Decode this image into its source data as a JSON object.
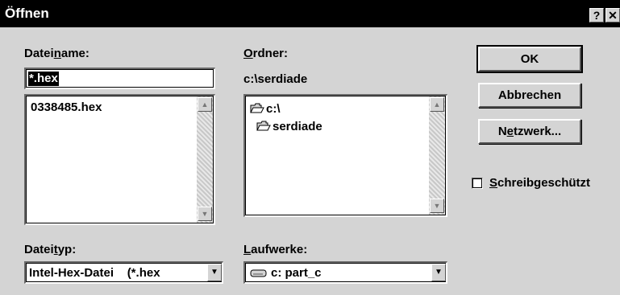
{
  "window": {
    "title": "Öffnen",
    "help_label": "?",
    "close_label": "✕"
  },
  "filename": {
    "label_pre": "Datei",
    "label_mnemonic": "n",
    "label_post": "ame:",
    "value": "*.hex",
    "files": [
      "0338485.hex"
    ]
  },
  "folder": {
    "label_mnemonic": "O",
    "label_post": "rdner:",
    "current_path": "c:\\serdiade",
    "items": [
      {
        "name": "c:\\",
        "icon": "open-folder-icon"
      },
      {
        "name": "serdiade",
        "icon": "open-folder-icon"
      }
    ]
  },
  "buttons": {
    "ok": "OK",
    "cancel": "Abbrechen",
    "network_pre": "N",
    "network_mnemonic": "e",
    "network_post": "tzwerk..."
  },
  "readonly": {
    "label_mnemonic": "S",
    "label_post": "chreibgeschützt",
    "checked": false
  },
  "filetype": {
    "label_pre": "Datei",
    "label_mnemonic": "t",
    "label_post": "yp:",
    "value": "Intel-Hex-Datei    (*.hex"
  },
  "drives": {
    "label_mnemonic": "L",
    "label_post": "aufwerke:",
    "value": "c: part_c",
    "icon": "drive-icon"
  }
}
